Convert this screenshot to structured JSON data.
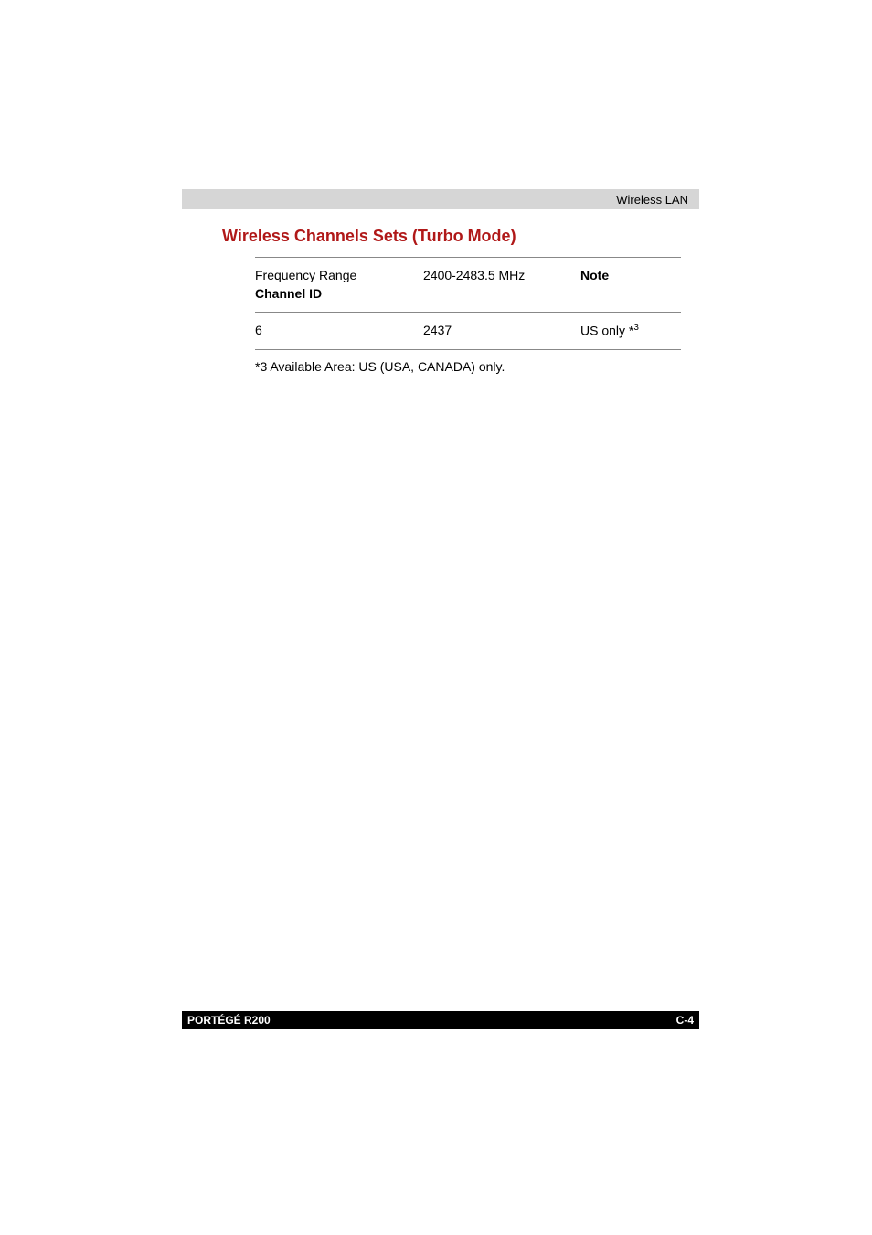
{
  "header": {
    "section_title": "Wireless LAN"
  },
  "main": {
    "heading": "Wireless Channels Sets (Turbo Mode)",
    "table": {
      "header": {
        "col1_line1": "Frequency Range",
        "col1_line2": "Channel ID",
        "col2": "2400-2483.5 MHz",
        "col3": "Note"
      },
      "rows": [
        {
          "channel_id": "6",
          "frequency": "2437",
          "note_prefix": "US only *",
          "note_sup": "3"
        }
      ]
    },
    "footnote": "*3 Available Area: US (USA, CANADA) only."
  },
  "footer": {
    "model": "PORTÉGÉ R200",
    "page_number": "C-4"
  },
  "chart_data": {
    "type": "table",
    "title": "Wireless Channels Sets (Turbo Mode)",
    "columns": [
      "Frequency Range Channel ID",
      "2400-2483.5 MHz",
      "Note"
    ],
    "rows": [
      [
        "6",
        "2437",
        "US only *3"
      ]
    ],
    "footnote": "*3 Available Area: US (USA, CANADA) only."
  }
}
